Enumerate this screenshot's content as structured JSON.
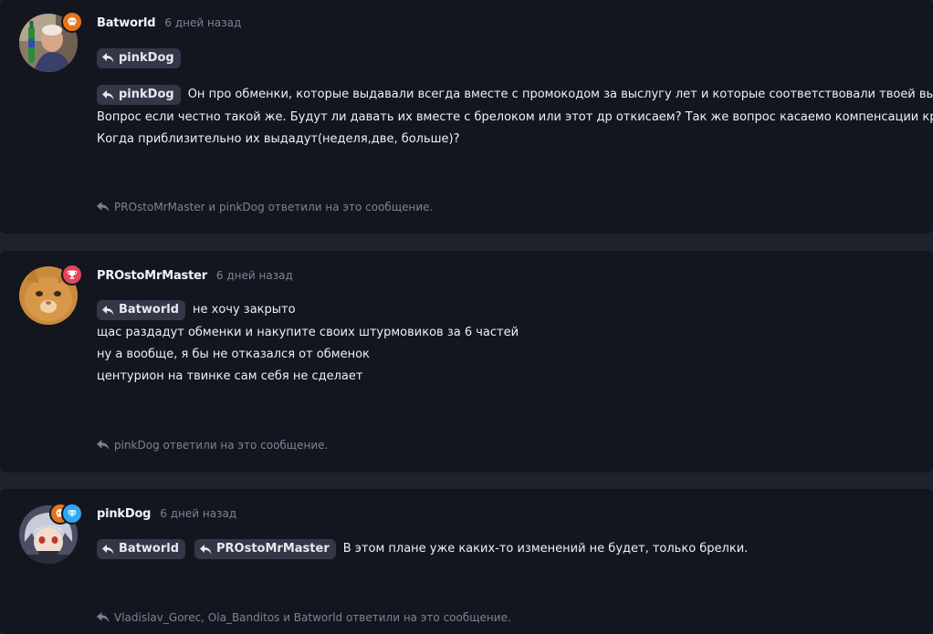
{
  "posts": [
    {
      "author": "Batworld",
      "time": "6 дней назад",
      "badges": [
        "skull-icon"
      ],
      "reply_chips_line1": [
        "pinkDog"
      ],
      "reply_chips_line2": [
        "pinkDog"
      ],
      "text_lines": [
        "Он про обменки, которые выдавали всегда вместе с промокодом за выслугу лет и которые соответствовали твоей выслуге.",
        "Вопрос если честно такой же. Будут ли давать их вместе с брелоком или этот др откисаем? Так же вопрос касаемо компенсации красок.",
        "Когда приблизительно их выдадут(неделя,две, больше)?"
      ],
      "replies": "PROstoMrMaster и pinkDog ответили на это сообщение."
    },
    {
      "author": "PROstoMrMaster",
      "time": "6 дней назад",
      "badges": [
        "trophy-icon"
      ],
      "reply_chips": [
        "Batworld"
      ],
      "text_lines": [
        "не хочу закрыто",
        "щас раздадут обменки и накупите своих штурмовиков за 6 частей",
        "ну а вообще, я бы не отказался от обменок",
        "центурион на твинке сам себя не сделает"
      ],
      "replies": "pinkDog ответили на это сообщение."
    },
    {
      "author": "pinkDog",
      "time": "6 дней назад",
      "badges": [
        "skull-icon",
        "diamond-icon"
      ],
      "reply_chips": [
        "Batworld",
        "PROstoMrMaster"
      ],
      "text_lines": [
        "В этом плане уже каких-то изменений не будет, только брелки."
      ],
      "replies": "Vladislav_Gorec, Ola_Banditos и Batworld ответили на это сообщение."
    }
  ],
  "colors": {
    "page_bg": "#1f222d",
    "card_bg": "#14161f",
    "chip_bg": "#333748",
    "muted": "#7c8196",
    "badge_orange": "#e8731b",
    "badge_red": "#e0475a",
    "badge_blue": "#2fa8f0"
  }
}
